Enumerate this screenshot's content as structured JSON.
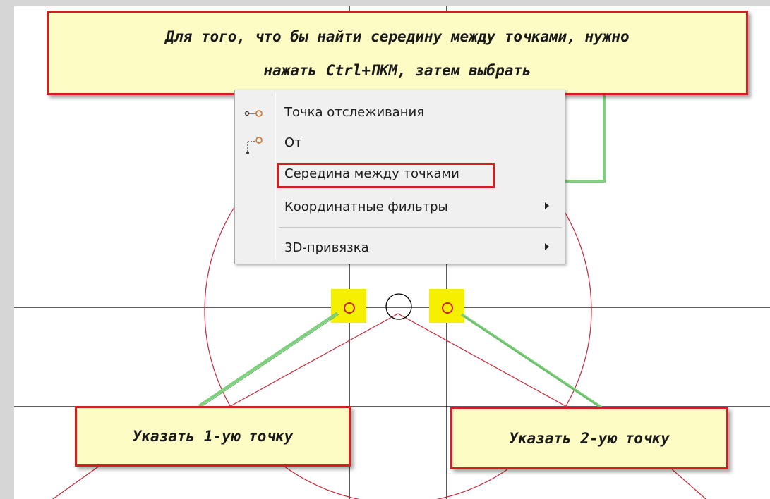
{
  "callouts": {
    "top_line1": "Для того, что бы найти середину между точками, нужно",
    "top_line2": "нажать Ctrl+ПКМ, затем выбрать",
    "point1": "Указать 1-ую точку",
    "point2": "Указать 2-ую точку"
  },
  "context_menu": {
    "items": [
      {
        "label": "Точка отслеживания",
        "icon": "tracking-point-icon",
        "submenu": false
      },
      {
        "label": "От",
        "icon": "from-icon",
        "submenu": false
      },
      {
        "label": "Середина между точками",
        "icon": "",
        "submenu": false,
        "highlighted": true
      },
      {
        "label": "Координатные фильтры",
        "icon": "",
        "submenu": true
      },
      {
        "label": "3D-привязка",
        "icon": "",
        "submenu": true
      }
    ]
  },
  "colors": {
    "callout_fill": "#fefcc5",
    "callout_border": "#d41e24",
    "arrow_green": "#7ed07e",
    "marker_yellow": "#f5f000",
    "geometry_red": "#c8283a"
  }
}
